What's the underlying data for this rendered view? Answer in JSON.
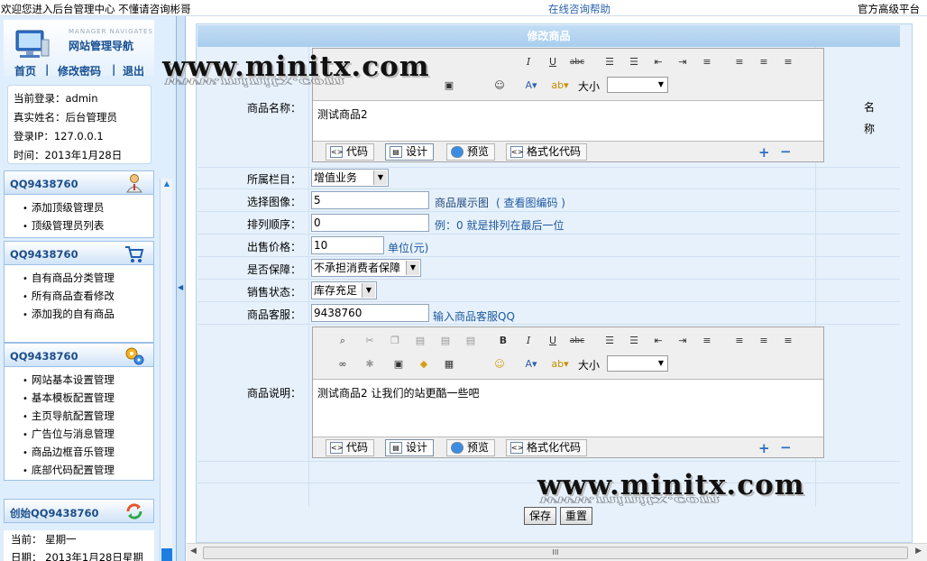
{
  "topbar": {
    "welcome": "欢迎您进入后台管理中心  不懂请咨询彬哥",
    "help": "在线咨询帮助",
    "platform": "官方高级平台"
  },
  "sidebar": {
    "header_sub": "MANAGER NAVIGATES",
    "header_title": "网站管理导航",
    "nav": [
      "首页",
      "|",
      "修改密码",
      "|",
      "退出"
    ],
    "info": {
      "login": "当前登录：admin",
      "realname": "真实姓名：后台管理员",
      "ip": "登录IP：127.0.0.1",
      "time": "时间：2013年1月28日"
    },
    "panels": [
      {
        "title": "QQ9438760",
        "icon": "admin-user-icon",
        "items": [
          "添加顶级管理员",
          "顶级管理员列表"
        ]
      },
      {
        "title": "QQ9438760",
        "icon": "shopping-cart-icon",
        "items": [
          "自有商品分类管理",
          "所有商品查看修改",
          "添加我的自有商品"
        ]
      },
      {
        "title": "QQ9438760",
        "icon": "settings-gears-icon",
        "items": [
          "网站基本设置管理",
          "基本模板配置管理",
          "主页导航配置管理",
          "广告位与消息管理",
          "商品边框音乐管理",
          "底部代码配置管理"
        ]
      },
      {
        "title": "创始QQ9438760",
        "icon": "refresh-arrows-icon",
        "items": []
      }
    ],
    "date": {
      "today": "当前：  星期一",
      "day": "日期：  2013年1月28日星期"
    }
  },
  "main": {
    "title": "修改商品",
    "name_label": "商品名称：",
    "name_value": "测试商品2",
    "category_label": "所属栏目：",
    "category_value": "增值业务",
    "image_label": "选择图像：",
    "image_value": "5",
    "image_hint": "商品展示图",
    "image_link": "( 查看图编码 )",
    "order_label": "排列顺序：",
    "order_value": "0",
    "order_hint": "例：0 就是排列在最后一位",
    "price_label": "出售价格：",
    "price_value": "10",
    "price_hint": "单位(元)",
    "guarantee_label": "是否保障：",
    "guarantee_value": "不承担消费者保障",
    "status_label": "销售状态：",
    "status_value": "库存充足",
    "service_label": "商品客服：",
    "service_value": "9438760",
    "service_hint": "输入商品客服QQ",
    "desc_label": "商品说明：",
    "desc_value": "测试商品2 让我们的站更酷一些吧",
    "right_label": [
      "名",
      "称"
    ],
    "size_label": "大小",
    "tabs": [
      "代码",
      "设计",
      "预览",
      "格式化代码"
    ],
    "save": "保存",
    "reset": "重置"
  },
  "watermark": {
    "text": "www.minitx.com"
  },
  "scroll": {
    "grip": "III"
  }
}
